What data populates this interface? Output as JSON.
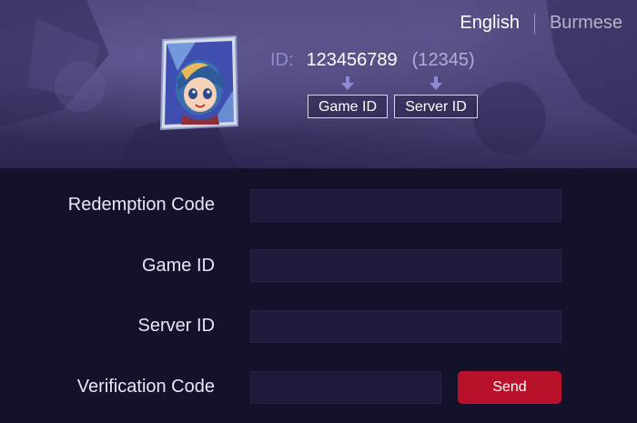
{
  "language": {
    "options": [
      "English",
      "Burmese"
    ],
    "selected": "English"
  },
  "profile": {
    "id_label": "ID:",
    "game_id": "123456789",
    "server_id": "(12345)",
    "game_id_hint": "Game ID",
    "server_id_hint": "Server ID"
  },
  "form": {
    "redemption_code": {
      "label": "Redemption Code",
      "value": "",
      "placeholder": ""
    },
    "game_id": {
      "label": "Game ID",
      "value": "",
      "placeholder": ""
    },
    "server_id": {
      "label": "Server ID",
      "value": "",
      "placeholder": ""
    },
    "verification_code": {
      "label": "Verification Code",
      "value": "",
      "placeholder": ""
    },
    "send_label": "Send"
  },
  "colors": {
    "page_background": "#14112a",
    "header_background": "#3a3462",
    "id_label": "#8f8ad8",
    "send_button": "#b8112a",
    "field_background": "#1d1a3c"
  },
  "icons": {
    "avatar": "hero-portrait",
    "hint_arrow": "arrow-down-icon"
  }
}
